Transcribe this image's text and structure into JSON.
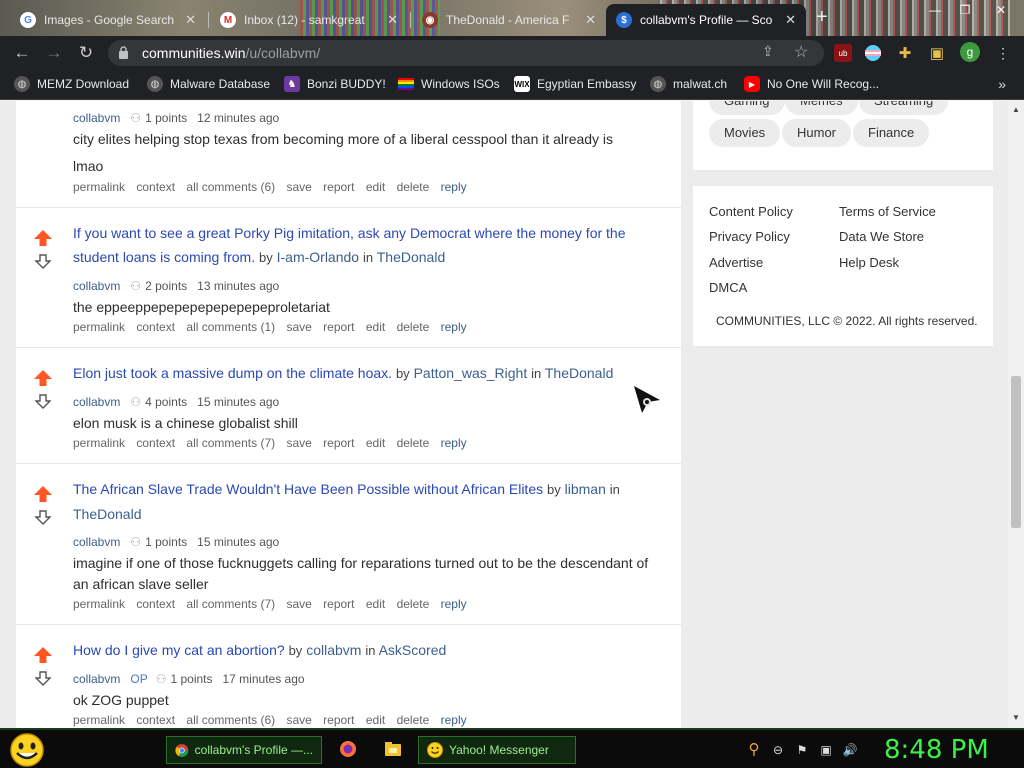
{
  "browser": {
    "tabs": [
      {
        "title": "Images - Google Search",
        "favicon": "google-icon",
        "active": false
      },
      {
        "title": "Inbox (12) - samkgreat",
        "favicon": "gmail-icon",
        "active": false
      },
      {
        "title": "TheDonald - America F",
        "favicon": "site-icon",
        "active": false
      },
      {
        "title": "collabvm's Profile — Sco",
        "favicon": "scored-icon",
        "active": true
      }
    ],
    "url_host": "communities.win",
    "url_path": "/u/collabvm/",
    "profile_initial": "g",
    "bookmarks": [
      {
        "label": "MEMZ Download",
        "icon": "globe-icon"
      },
      {
        "label": "Malware Database",
        "icon": "globe-icon"
      },
      {
        "label": "Bonzi BUDDY!",
        "icon": "bonzi-icon"
      },
      {
        "label": "Windows ISOs",
        "icon": "rainbow-flag-icon"
      },
      {
        "label": "Egyptian Embassy",
        "icon": "wix-icon"
      },
      {
        "label": "malwat.ch",
        "icon": "globe-icon"
      },
      {
        "label": "No One Will Recog...",
        "icon": "youtube-icon"
      }
    ],
    "more": "»"
  },
  "feed": {
    "actions": {
      "permalink": "permalink",
      "context": "context",
      "save": "save",
      "report": "report",
      "edit": "edit",
      "delete": "delete",
      "reply": "reply"
    },
    "by": "by",
    "in": "in",
    "posts": [
      {
        "author": "collabvm",
        "points": "1 points",
        "time": "12 minutes ago",
        "text": "city elites helping stop texas from becoming more of a liberal cesspool than it already is",
        "text2": "lmao",
        "comments": "all comments (6)"
      },
      {
        "title": "If you want to see a great Porky Pig imitation, ask any Democrat where the money for the student loans is coming from.",
        "op": "I-am-Orlando",
        "community": "TheDonald",
        "author": "collabvm",
        "points": "2 points",
        "time": "13 minutes ago",
        "text": "the eppeeppepepepepepepepeproletariat",
        "comments": "all comments (1)"
      },
      {
        "title": "Elon just took a massive dump on the climate hoax.",
        "op": "Patton_was_Right",
        "community": "TheDonald",
        "author": "collabvm",
        "points": "4 points",
        "time": "15 minutes ago",
        "text": "elon musk is a chinese globalist shill",
        "comments": "all comments (7)"
      },
      {
        "title": "The African Slave Trade Wouldn't Have Been Possible without African Elites",
        "op": "libman",
        "community": "TheDonald",
        "author": "collabvm",
        "points": "1 points",
        "time": "15 minutes ago",
        "text": "imagine if one of those fucknuggets calling for reparations turned out to be the descendant of an african slave seller",
        "comments": "all comments (7)"
      },
      {
        "title": "How do I give my cat an abortion?",
        "op": "collabvm",
        "community": "AskScored",
        "author": "collabvm",
        "author_tag": "OP",
        "points": "1 points",
        "time": "17 minutes ago",
        "text": "ok ZOG puppet",
        "comments": "all comments (6)"
      }
    ]
  },
  "sidebar": {
    "chips_partial": [
      "Gaming",
      "Memes",
      "Streaming"
    ],
    "chips": [
      "Movies",
      "Humor",
      "Finance"
    ],
    "footer_links": {
      "content_policy": "Content Policy",
      "terms": "Terms of Service",
      "privacy": "Privacy Policy",
      "data": "Data We Store",
      "advertise": "Advertise",
      "help": "Help Desk",
      "dmca": "DMCA"
    },
    "copyright": "COMMUNITIES, LLC © 2022. All rights reserved."
  },
  "taskbar": {
    "tasks": [
      {
        "label": "collabvm's Profile —...",
        "icon": "chrome-icon"
      },
      {
        "label": "Yahoo! Messenger",
        "icon": "yahoo-smiley-icon"
      }
    ],
    "clock": "8:48 PM"
  },
  "colors": {
    "upvote": "#ff5722",
    "link": "#2a49b5",
    "user": "#3b5e8c",
    "clock": "#3cf04a"
  }
}
